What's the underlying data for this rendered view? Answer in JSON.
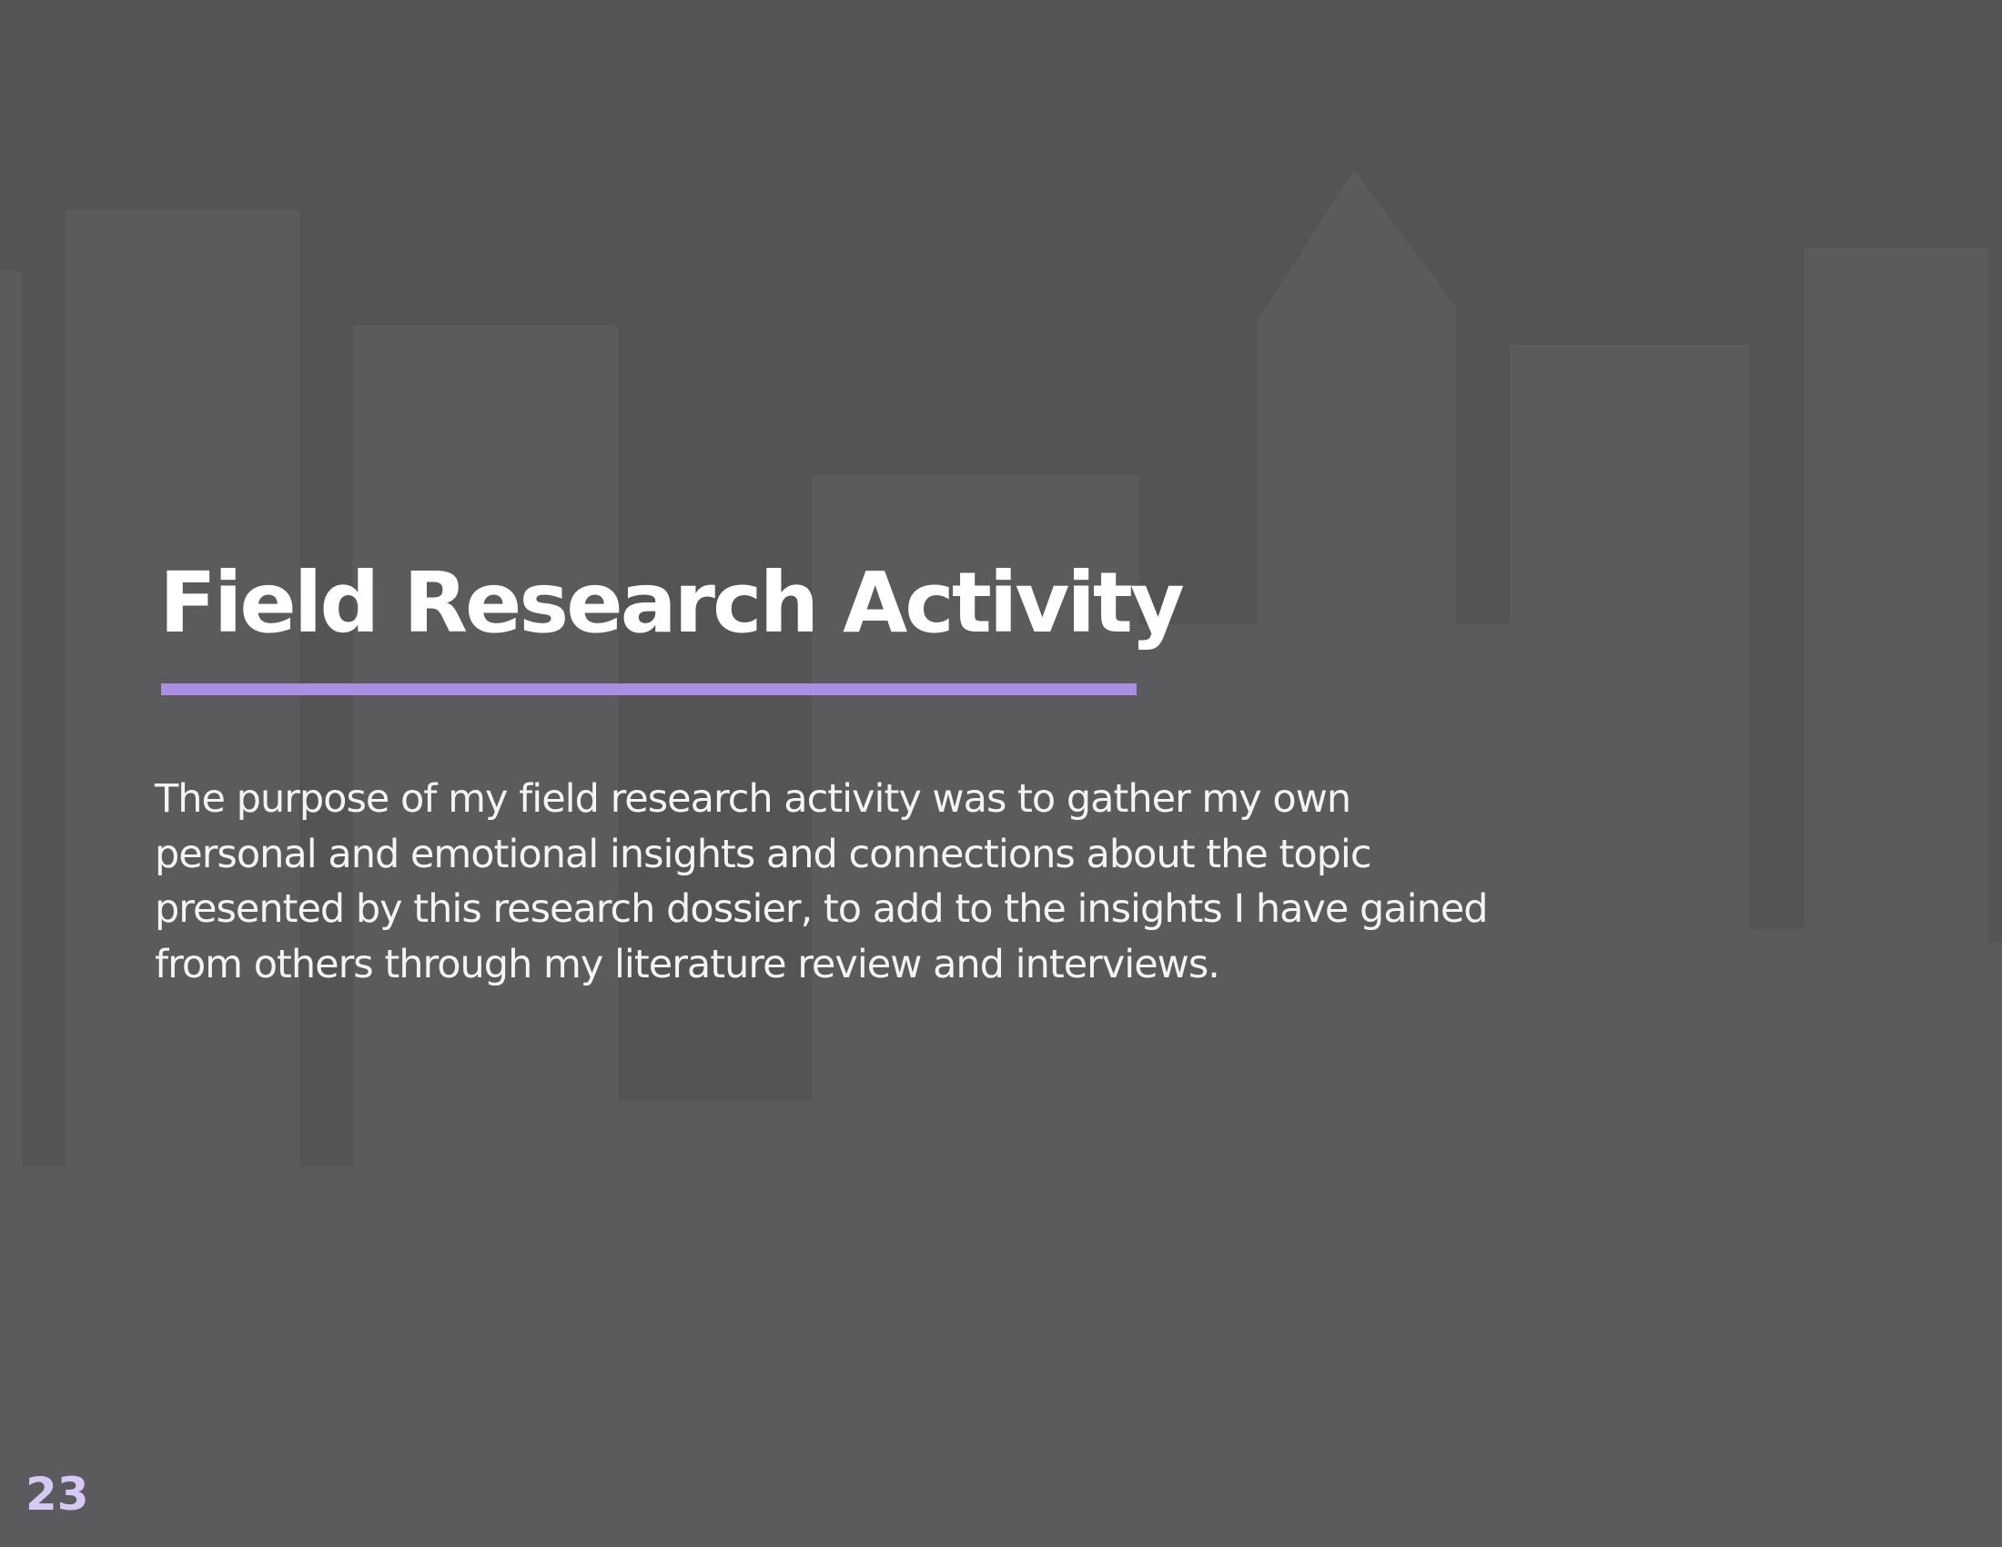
{
  "page": {
    "title": "Field Research Activity",
    "body": "The purpose of my field research activity was to gather my own personal and emotional insights and connections about the topic presented by this research dossier, to add to the insights I have gained from others through my literature review and interviews.",
    "page_number": "23"
  },
  "theme": {
    "background": "#5b5b5d",
    "accent": "#a98ee4",
    "page_number_color": "#d7c9f6",
    "text_color": "#ffffff"
  }
}
